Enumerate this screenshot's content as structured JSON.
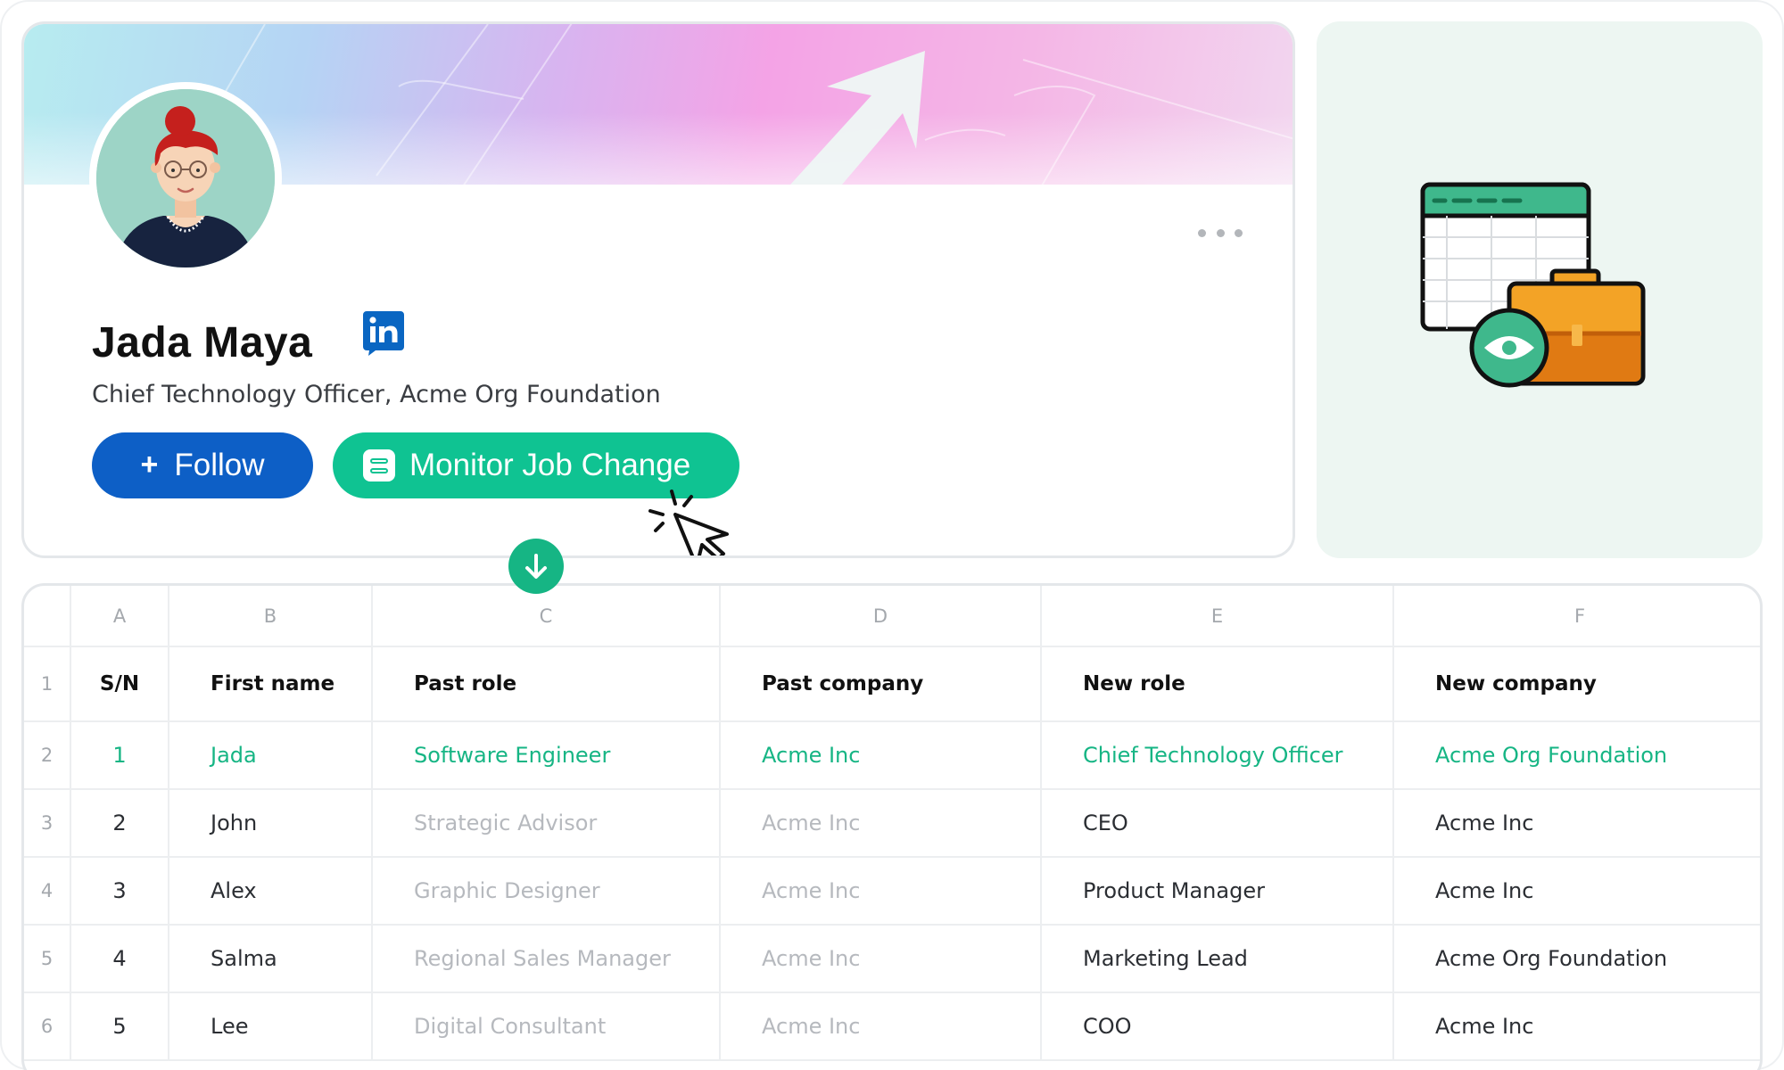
{
  "profile": {
    "name": "Jada Maya",
    "title": "Chief Technology Officer, Acme Org Foundation",
    "linkedin_icon": "linkedin-icon",
    "follow_label": "Follow",
    "follow_icon": "+",
    "monitor_label": "Monitor Job Change",
    "more_icon": "more-horizontal-icon"
  },
  "colors": {
    "follow_button": "#0d5fc6",
    "monitor_button": "#0fc392",
    "highlight_text": "#16b584",
    "illustration_bg": "#edf6f2"
  },
  "sheet": {
    "column_letters": [
      "A",
      "B",
      "C",
      "D",
      "E",
      "F"
    ],
    "header_row_number": "1",
    "headers": [
      "S/N",
      "First name",
      "Past role",
      "Past company",
      "New role",
      "New company"
    ],
    "rows": [
      {
        "row_number": "2",
        "sn": "1",
        "first_name": "Jada",
        "past_role": "Software Engineer",
        "past_company": "Acme Inc",
        "new_role": "Chief Technology Officer",
        "new_company": "Acme Org Foundation"
      },
      {
        "row_number": "3",
        "sn": "2",
        "first_name": "John",
        "past_role": "Strategic Advisor",
        "past_company": "Acme Inc",
        "new_role": "CEO",
        "new_company": "Acme Inc"
      },
      {
        "row_number": "4",
        "sn": "3",
        "first_name": "Alex",
        "past_role": "Graphic Designer",
        "past_company": "Acme Inc",
        "new_role": "Product Manager",
        "new_company": "Acme Inc"
      },
      {
        "row_number": "5",
        "sn": "4",
        "first_name": "Salma",
        "past_role": "Regional Sales Manager",
        "past_company": "Acme Inc",
        "new_role": "Marketing Lead",
        "new_company": "Acme Org Foundation"
      },
      {
        "row_number": "6",
        "sn": "5",
        "first_name": "Lee",
        "past_role": "Digital Consultant",
        "past_company": "Acme Inc",
        "new_role": "COO",
        "new_company": "Acme Inc"
      }
    ]
  }
}
